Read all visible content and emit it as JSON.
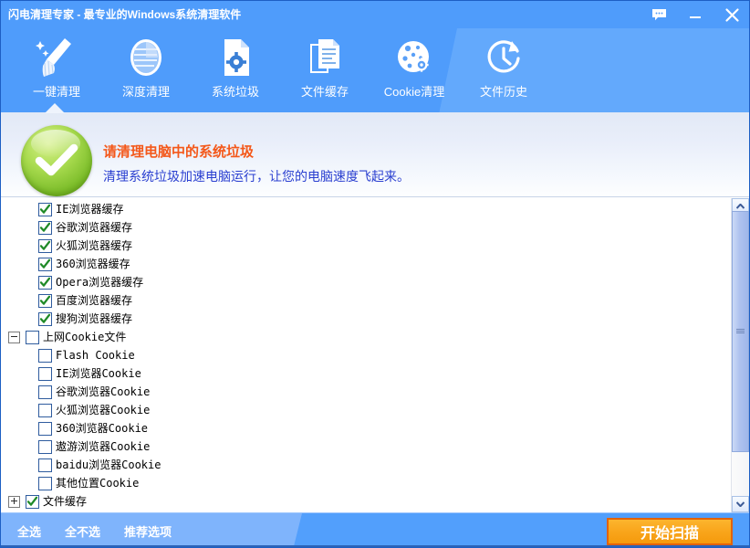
{
  "window": {
    "title": "闪电清理专家 - 最专业的Windows系统清理软件",
    "controls": [
      {
        "name": "feedback-icon",
        "label": "反馈"
      },
      {
        "name": "minimize-icon",
        "label": "最小化"
      },
      {
        "name": "close-icon",
        "label": "关闭"
      }
    ]
  },
  "toolbar": {
    "active_index": 0,
    "tabs": [
      {
        "label": "一键清理",
        "icon": "broom-icon"
      },
      {
        "label": "深度清理",
        "icon": "disk-icon"
      },
      {
        "label": "系统垃圾",
        "icon": "file-gear-icon"
      },
      {
        "label": "文件缓存",
        "icon": "document-lines-icon"
      },
      {
        "label": "Cookie清理",
        "icon": "cookie-icon"
      },
      {
        "label": "文件历史",
        "icon": "clock-history-icon"
      }
    ]
  },
  "banner": {
    "status_icon": "green-check-circle-icon",
    "title": "请清理电脑中的系统垃圾",
    "subtitle": "清理系统垃圾加速电脑运行，让您的电脑速度飞起来。",
    "title_color": "#f4581a",
    "subtitle_color": "#2a3fd0"
  },
  "tree": {
    "rows": [
      {
        "label": "IE浏览器缓存",
        "indent": 1,
        "checked": true,
        "expander": "none"
      },
      {
        "label": "谷歌浏览器缓存",
        "indent": 1,
        "checked": true,
        "expander": "none"
      },
      {
        "label": "火狐浏览器缓存",
        "indent": 1,
        "checked": true,
        "expander": "none"
      },
      {
        "label": "360浏览器缓存",
        "indent": 1,
        "checked": true,
        "expander": "none"
      },
      {
        "label": "Opera浏览器缓存",
        "indent": 1,
        "checked": true,
        "expander": "none"
      },
      {
        "label": "百度浏览器缓存",
        "indent": 1,
        "checked": true,
        "expander": "none"
      },
      {
        "label": "搜狗浏览器缓存",
        "indent": 1,
        "checked": true,
        "expander": "none"
      },
      {
        "label": "上网Cookie文件",
        "indent": 0,
        "checked": false,
        "expander": "minus"
      },
      {
        "label": "Flash Cookie",
        "indent": 1,
        "checked": false,
        "expander": "none"
      },
      {
        "label": "IE浏览器Cookie",
        "indent": 1,
        "checked": false,
        "expander": "none"
      },
      {
        "label": "谷歌浏览器Cookie",
        "indent": 1,
        "checked": false,
        "expander": "none"
      },
      {
        "label": "火狐浏览器Cookie",
        "indent": 1,
        "checked": false,
        "expander": "none"
      },
      {
        "label": "360浏览器Cookie",
        "indent": 1,
        "checked": false,
        "expander": "none"
      },
      {
        "label": "遨游浏览器Cookie",
        "indent": 1,
        "checked": false,
        "expander": "none"
      },
      {
        "label": "baidu浏览器Cookie",
        "indent": 1,
        "checked": false,
        "expander": "none"
      },
      {
        "label": "其他位置Cookie",
        "indent": 1,
        "checked": false,
        "expander": "none"
      },
      {
        "label": "文件缓存",
        "indent": 0,
        "checked": true,
        "expander": "plus"
      }
    ]
  },
  "scrollbar": {
    "up_icon": "chevron-up-icon",
    "down_icon": "chevron-down-icon",
    "thumb_grip_icon": "grip-lines-icon"
  },
  "footer": {
    "links": [
      {
        "label": "全选",
        "name": "select-all-link"
      },
      {
        "label": "全不选",
        "name": "select-none-link"
      },
      {
        "label": "推荐选项",
        "name": "recommended-options-link"
      }
    ],
    "scan_button": "开始扫描",
    "scan_button_color": "#f9a51b",
    "scan_button_border": "#e2620c"
  }
}
